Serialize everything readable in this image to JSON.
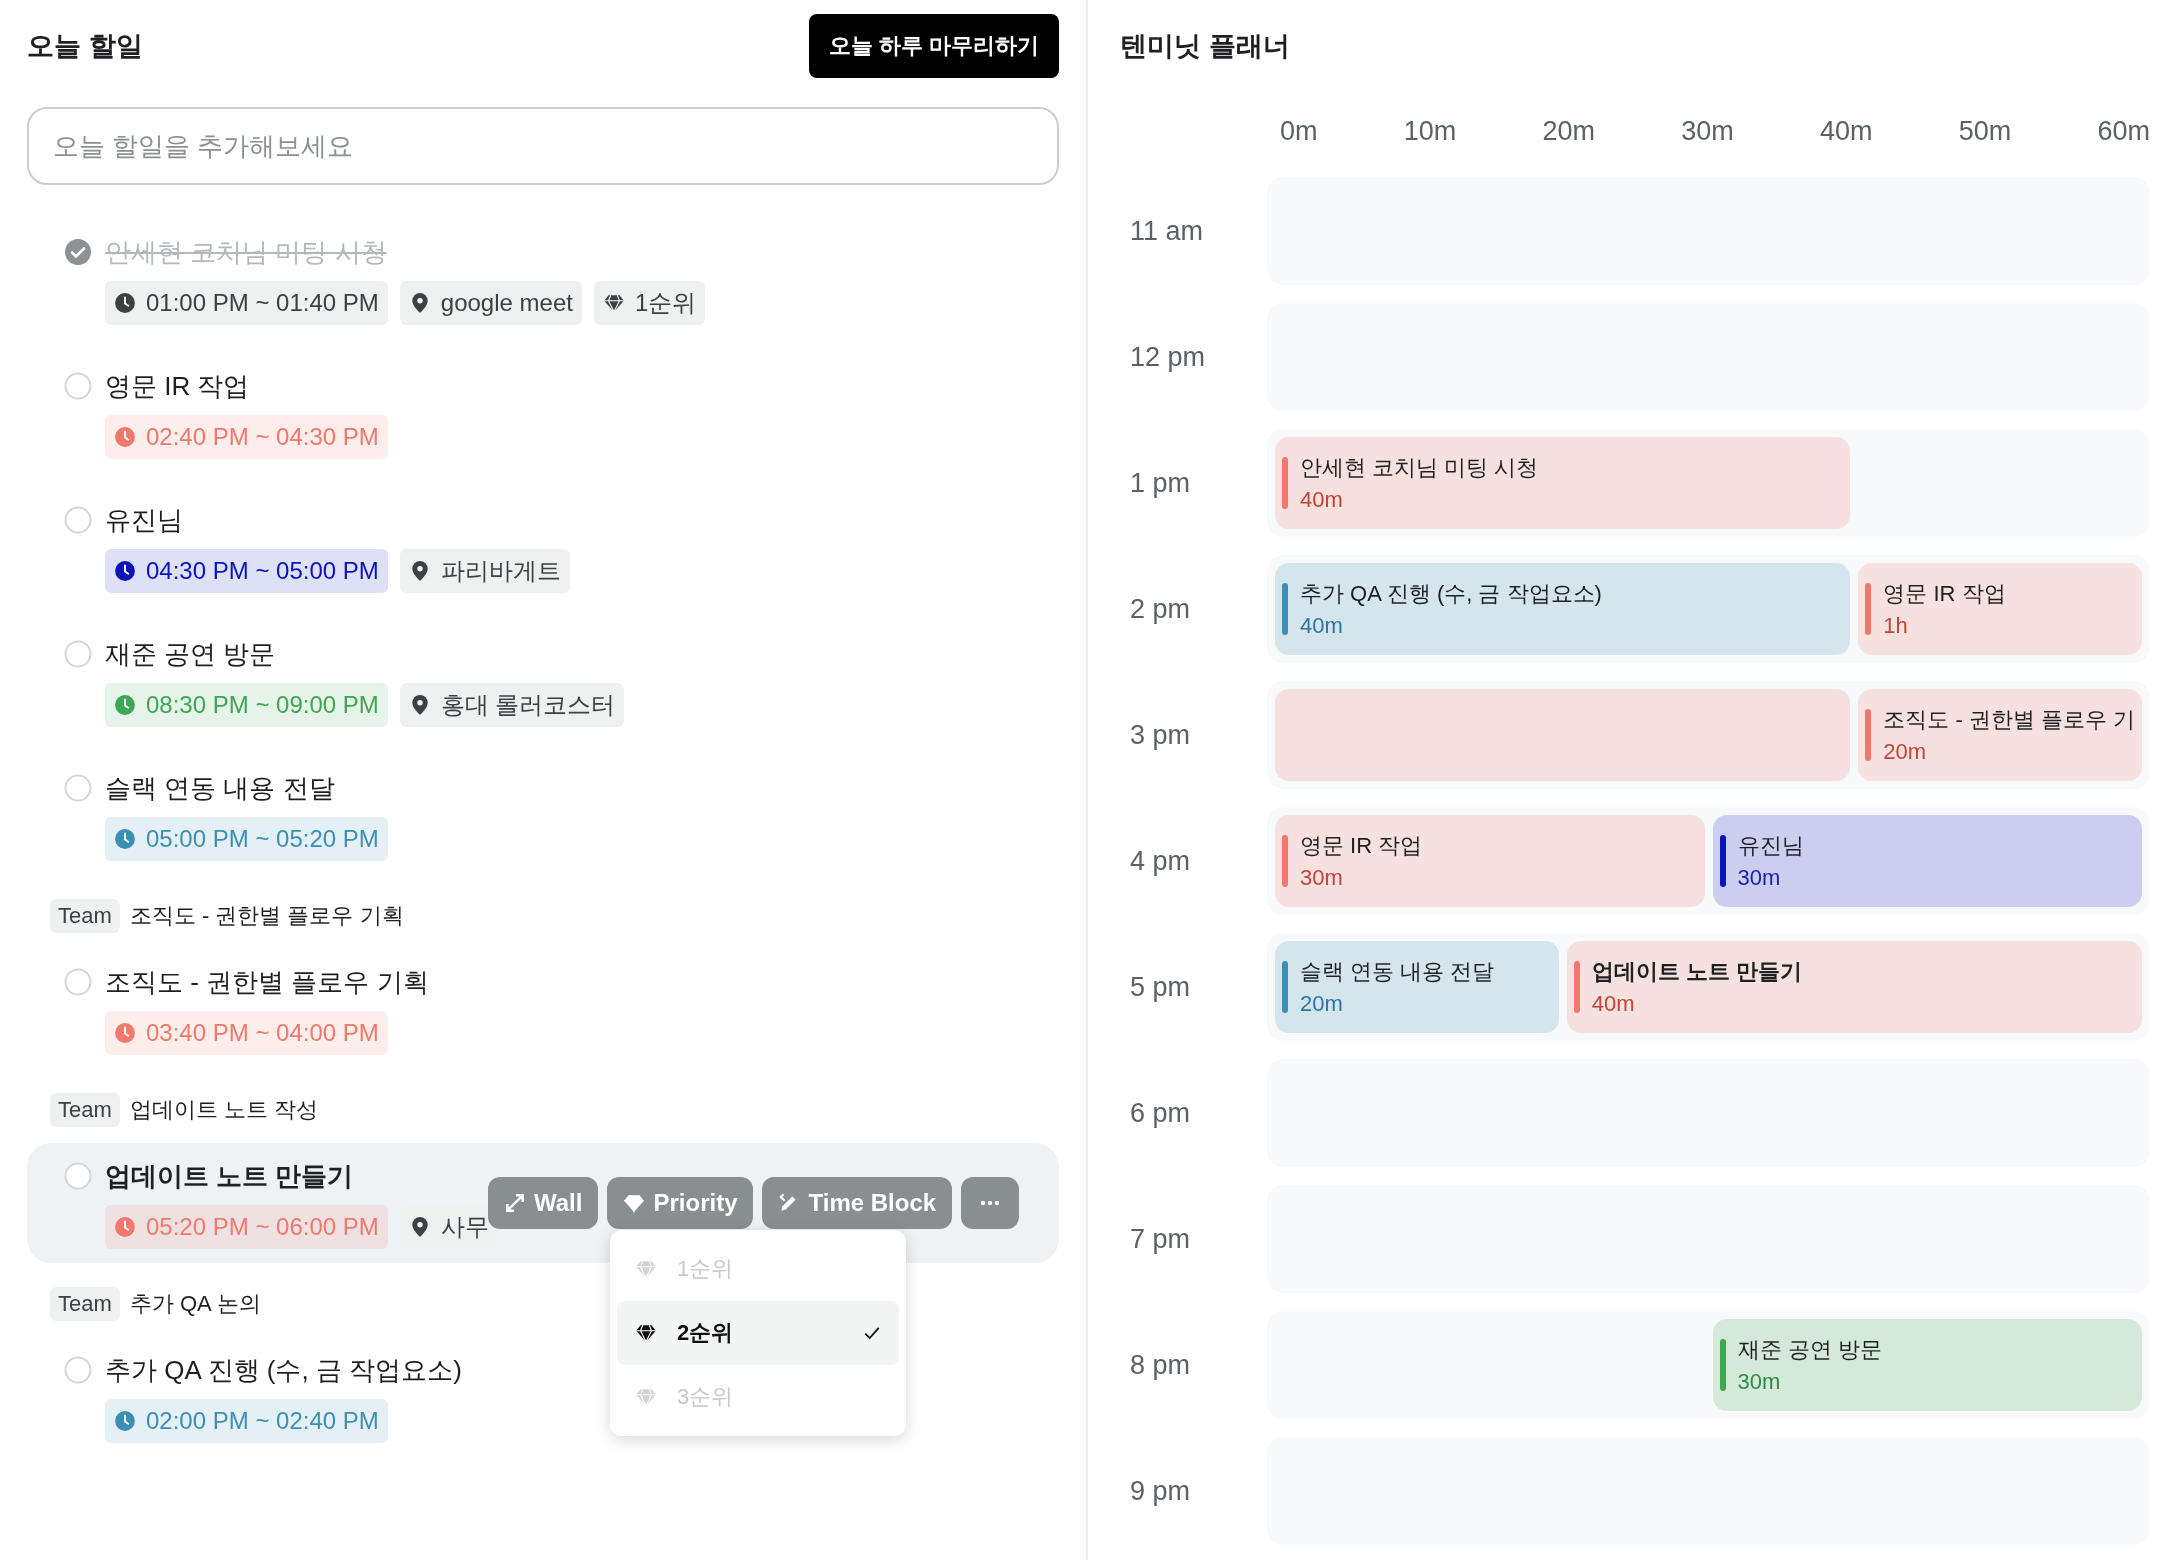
{
  "todo": {
    "title": "오늘 할일",
    "finish_button": "오늘 하루 마무리하기",
    "add_field": {
      "placeholder": "오늘 할일을 추가해보세요"
    },
    "items": [
      {
        "kind": "task",
        "title": "안세현 코치님 미팅 시청",
        "checked": true,
        "selected": false,
        "chips": [
          {
            "kind": "time",
            "text": "01:00 PM ~ 01:40 PM",
            "color": "#3c4043"
          },
          {
            "kind": "place",
            "text": "google meet"
          },
          {
            "kind": "priority",
            "text": "1순위"
          }
        ]
      },
      {
        "kind": "task",
        "title": "영문 IR 작업",
        "checked": false,
        "selected": false,
        "chips": [
          {
            "kind": "time",
            "text": "02:40 PM ~ 04:30 PM",
            "color": "#f0786c"
          }
        ]
      },
      {
        "kind": "task",
        "title": "유진님",
        "checked": false,
        "selected": false,
        "chips": [
          {
            "kind": "time",
            "text": "04:30 PM ~ 05:00 PM",
            "color": "#0b14b8"
          },
          {
            "kind": "place",
            "text": "파리바게트"
          }
        ]
      },
      {
        "kind": "task",
        "title": "재준 공연 방문",
        "checked": false,
        "selected": false,
        "chips": [
          {
            "kind": "time",
            "text": "08:30 PM ~ 09:00 PM",
            "color": "#3fa654"
          },
          {
            "kind": "place",
            "text": "홍대 롤러코스터"
          }
        ]
      },
      {
        "kind": "task",
        "title": "슬랙 연동 내용 전달",
        "checked": false,
        "selected": false,
        "chips": [
          {
            "kind": "time",
            "text": "05:00 PM ~ 05:20 PM",
            "color": "#3b8fb5"
          }
        ]
      },
      {
        "kind": "team",
        "tag": "Team",
        "title": "조직도 - 권한별 플로우 기획"
      },
      {
        "kind": "task",
        "title": "조직도 - 권한별 플로우 기획",
        "checked": false,
        "selected": false,
        "chips": [
          {
            "kind": "time",
            "text": "03:40 PM ~ 04:00 PM",
            "color": "#f0786c"
          }
        ]
      },
      {
        "kind": "team",
        "tag": "Team",
        "title": "업데이트 노트 작성"
      },
      {
        "kind": "task",
        "title": "업데이트 노트 만들기",
        "checked": false,
        "selected": true,
        "chips": [
          {
            "kind": "time",
            "text": "05:20 PM ~ 06:00 PM",
            "color": "#f0786c"
          },
          {
            "kind": "place",
            "text": "사무"
          }
        ],
        "toolbar": [
          {
            "kind": "wall",
            "label": "Wall"
          },
          {
            "kind": "priority",
            "label": "Priority"
          },
          {
            "kind": "timeblock",
            "label": "Time Block"
          },
          {
            "kind": "more"
          }
        ],
        "priority_menu": [
          {
            "label": "1순위",
            "selected": false
          },
          {
            "label": "2순위",
            "selected": true
          },
          {
            "label": "3순위",
            "selected": false
          }
        ]
      },
      {
        "kind": "team",
        "tag": "Team",
        "title": "추가 QA 논의"
      },
      {
        "kind": "task",
        "title": "추가 QA 진행 (수, 금 작업요소)",
        "checked": false,
        "selected": false,
        "chips": [
          {
            "kind": "time",
            "text": "02:00 PM ~ 02:40 PM",
            "color": "#3b8fb5"
          }
        ]
      }
    ]
  },
  "planner": {
    "title": "텐미닛 플래너",
    "columns": [
      "0m",
      "10m",
      "20m",
      "30m",
      "40m",
      "50m",
      "60m"
    ],
    "rows": [
      {
        "label": "11 am",
        "blocks": []
      },
      {
        "label": "12 pm",
        "blocks": []
      },
      {
        "label": "1 pm",
        "blocks": [
          {
            "kind": "twothirds",
            "title": "안세현 코치님 미팅 시청",
            "duration": "40m",
            "color": "#f0786c"
          }
        ]
      },
      {
        "label": "2 pm",
        "blocks": [
          {
            "kind": "twothirds",
            "title": "추가 QA 진행 (수, 금 작업요소)",
            "duration": "40m",
            "color": "#3b8fb5"
          },
          {
            "kind": "third",
            "title": "영문 IR 작업",
            "duration": "1h",
            "color": "#f0786c"
          }
        ]
      },
      {
        "label": "3 pm",
        "blocks": [
          {
            "kind": "twothirds"
          },
          {
            "kind": "third",
            "title": "조직도 - 권한별 플로우 기",
            "duration": "20m",
            "color": "#f0786c"
          }
        ]
      },
      {
        "label": "4 pm",
        "blocks": [
          {
            "kind": "half",
            "title": "영문 IR 작업",
            "duration": "30m",
            "color": "#f0786c"
          },
          {
            "kind": "half",
            "title": "유진님",
            "duration": "30m",
            "color": "#0b14b8"
          }
        ]
      },
      {
        "label": "5 pm",
        "blocks": [
          {
            "kind": "third",
            "title": "슬랙 연동 내용 전달",
            "duration": "20m",
            "color": "#3b8fb5"
          },
          {
            "kind": "twothirds",
            "title": "업데이트 노트 만들기",
            "duration": "40m",
            "color": "#f0786c",
            "selected": true
          }
        ]
      },
      {
        "label": "6 pm",
        "blocks": []
      },
      {
        "label": "7 pm",
        "blocks": []
      },
      {
        "label": "8 pm",
        "blocks": [
          {
            "kind": "gaphalf"
          },
          {
            "kind": "half",
            "title": "재준 공연 방문",
            "duration": "30m",
            "color": "#3fa654"
          }
        ]
      },
      {
        "label": "9 pm",
        "blocks": []
      }
    ]
  }
}
